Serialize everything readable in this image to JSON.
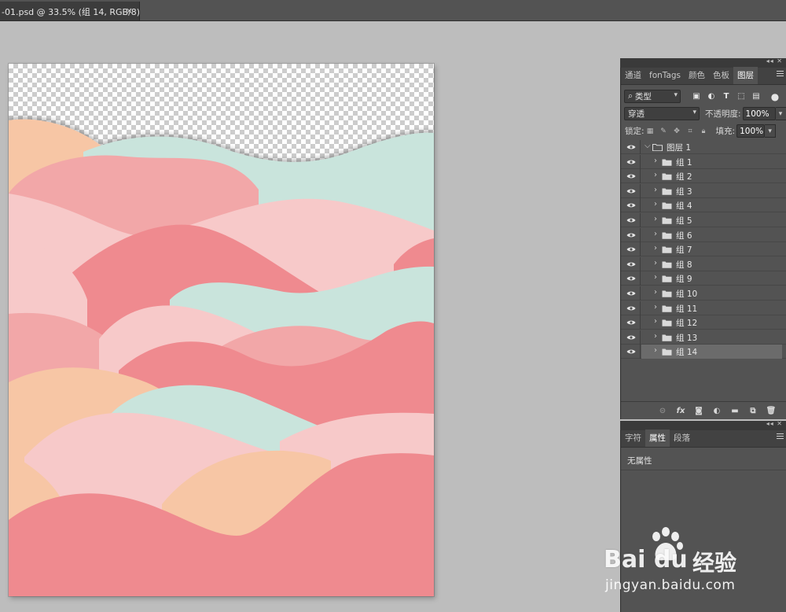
{
  "document": {
    "tab_title": "-01.psd @ 33.5% (组 14, RGB/8) *",
    "close_glyph": "×"
  },
  "layers_panel": {
    "tabs": [
      {
        "label": "通道",
        "active": false
      },
      {
        "label": "fonTags",
        "active": false
      },
      {
        "label": "颜色",
        "active": false
      },
      {
        "label": "色板",
        "active": false
      },
      {
        "label": "图层",
        "active": true
      }
    ],
    "filter": {
      "label": "类型",
      "search_glyph": "⌕"
    },
    "blend_mode": "穿透",
    "opacity_label": "不透明度:",
    "opacity_value": "100%",
    "lock_label": "锁定:",
    "fill_label": "填充:",
    "fill_value": "100%",
    "group_root": {
      "name": "图层 1",
      "expanded": true
    },
    "groups": [
      "组 1",
      "组 2",
      "组 3",
      "组 4",
      "组 5",
      "组 6",
      "组 7",
      "组 8",
      "组 9",
      "组 10",
      "组 11",
      "组 12",
      "组 13",
      "组 14"
    ],
    "selected_group": "组 14",
    "bottom_icons": [
      "link-icon",
      "fx-icon",
      "mask-icon",
      "adjustment-icon",
      "new-group-icon",
      "new-layer-icon",
      "trash-icon"
    ],
    "fx_label": "fx"
  },
  "properties_panel": {
    "tabs": [
      {
        "label": "字符",
        "active": false
      },
      {
        "label": "属性",
        "active": true
      },
      {
        "label": "段落",
        "active": false
      }
    ],
    "empty_text": "无属性"
  },
  "watermark": {
    "logo_text": "Bai du",
    "logo_cn": "经验",
    "url": "jingyan.baidu.com"
  },
  "colors": {
    "peach": "#f7c6a5",
    "mint": "#c9e4dc",
    "pink_light": "#f7c9c9",
    "pink_mid": "#f2a7a8",
    "coral": "#ef8a8f",
    "panel_bg": "#535353",
    "workspace_bg": "#bdbdbd"
  }
}
